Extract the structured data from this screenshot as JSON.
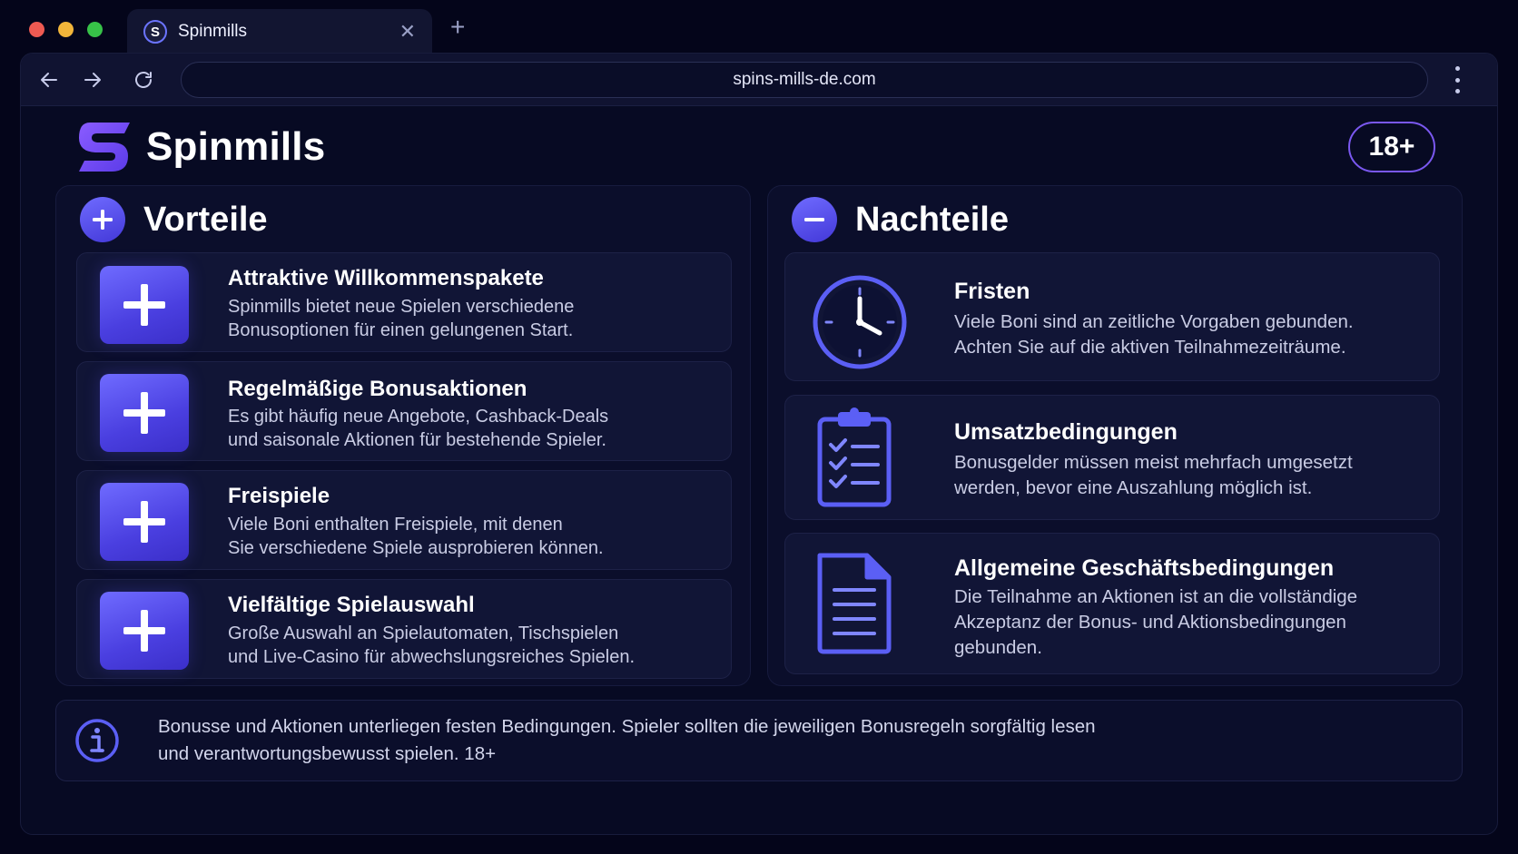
{
  "browser": {
    "tab_favicon": "S",
    "tab_title": "Spinmills",
    "close_glyph": "✕",
    "new_tab_glyph": "+",
    "url": "spins-mills-de.com"
  },
  "header": {
    "brand_name": "Spinmills",
    "age_badge": "18+"
  },
  "pros": {
    "title": "Vorteile",
    "items": [
      {
        "title": "Attraktive Willkommenspakete",
        "line1": "Spinmills bietet neue Spielen verschiedene",
        "line2": "Bonusoptionen für einen gelungenen Start."
      },
      {
        "title": "Regelmäßige Bonusaktionen",
        "line1": "Es gibt häufig neue Angebote, Cashback-Deals",
        "line2": "und saisonale Aktionen für bestehende Spieler."
      },
      {
        "title": "Freispiele",
        "line1": "Viele Boni enthalten Freispiele, mit denen",
        "line2": "Sie verschiedene Spiele ausprobieren können."
      },
      {
        "title": "Vielfältige Spielauswahl",
        "line1": "Große Auswahl an Spielautomaten, Tischspielen",
        "line2": "und Live-Casino für abwechslungsreiches Spielen."
      }
    ]
  },
  "cons": {
    "title": "Nachteile",
    "items": [
      {
        "title": "Fristen",
        "line1": "Viele Boni sind an zeitliche Vorgaben gebunden.",
        "line2": "Achten Sie auf die aktiven Teilnahmezeiträume.",
        "icon": "clock-icon"
      },
      {
        "title": "Umsatzbedingungen",
        "line1": "Bonusgelder müssen meist mehrfach umgesetzt",
        "line2": "werden, bevor eine Auszahlung möglich ist.",
        "icon": "clipboard-checklist-icon"
      },
      {
        "title": "Allgemeine Geschäftsbedingungen",
        "line1": "Die Teilnahme an Aktionen ist an die vollständige",
        "line2": "Akzeptanz der Bonus- und Aktionsbedingungen",
        "line3": "gebunden.",
        "icon": "document-icon"
      }
    ]
  },
  "notice": {
    "line1": "Bonusse und Aktionen unterliegen festen Bedingungen. Spieler sollten die jeweiligen Bonusregeln sorgfältig lesen",
    "line2": "und verantwortungsbewusst spielen. 18+"
  },
  "colors": {
    "accent": "#5b52f0",
    "background": "#04051a",
    "card": "#111536"
  }
}
